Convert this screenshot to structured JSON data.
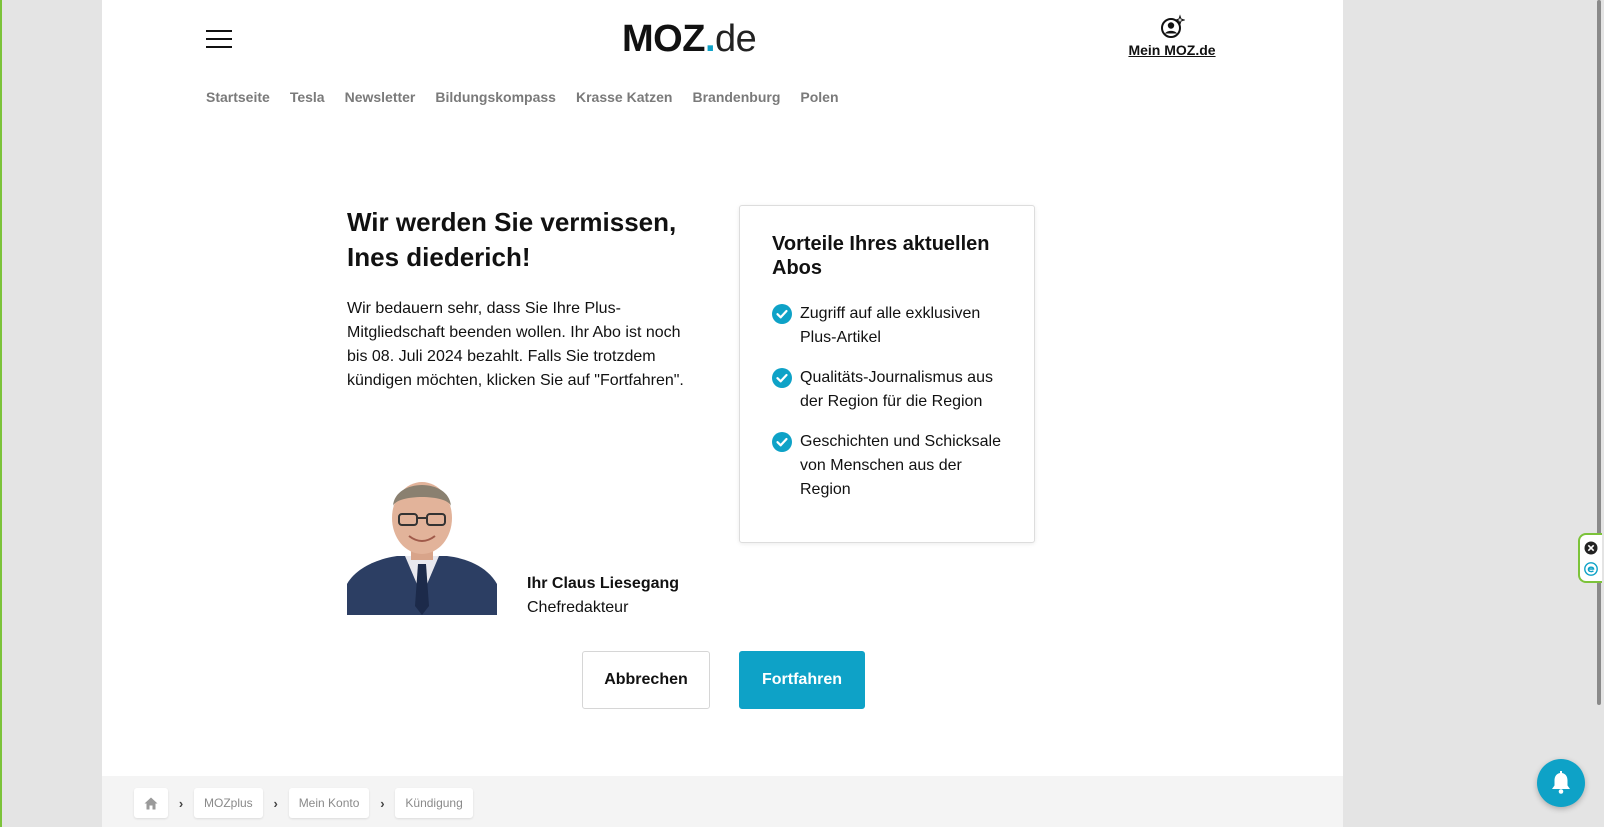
{
  "header": {
    "logo_main": "MOZ",
    "logo_dot": ".",
    "logo_suffix": "de",
    "account_label": "Mein MOZ.de"
  },
  "nav": {
    "items": [
      "Startseite",
      "Tesla",
      "Newsletter",
      "Bildungskompass",
      "Krasse Katzen",
      "Brandenburg",
      "Polen"
    ]
  },
  "main": {
    "headline_line1": "Wir werden Sie vermissen,",
    "headline_line2": "Ines diederich!",
    "intro": "Wir bedauern sehr, dass Sie Ihre Plus-Mitgliedschaft beenden wollen. Ihr Abo ist noch bis 08. Juli 2024 bezahlt. Falls Sie trotzdem kündigen möchten, klicken Sie auf \"Fortfahren\".",
    "signature_name": "Ihr Claus Liesegang",
    "signature_role": "Chefredakteur"
  },
  "benefits": {
    "title": "Vorteile Ihres aktuellen Abos",
    "items": [
      "Zugriff auf alle exklusiven Plus-Artikel",
      "Qualitäts-Journalismus aus der Region für die Region",
      "Geschichten und Schicksale von Menschen aus der Region"
    ]
  },
  "buttons": {
    "cancel": "Abbrechen",
    "continue": "Fortfahren"
  },
  "breadcrumb": {
    "items": [
      "MOZplus",
      "Mein Konto",
      "Kündigung"
    ],
    "separator": "›"
  },
  "icons": {
    "menu": "hamburger-icon",
    "account": "user-sparkle-icon",
    "home": "home-icon",
    "check": "check-circle-icon",
    "bell": "bell-icon",
    "close": "close-icon",
    "widget": "e-icon"
  },
  "colors": {
    "accent": "#0ea2c7",
    "side_accent": "#7cc33a",
    "nav_text": "#7a7a7a"
  }
}
